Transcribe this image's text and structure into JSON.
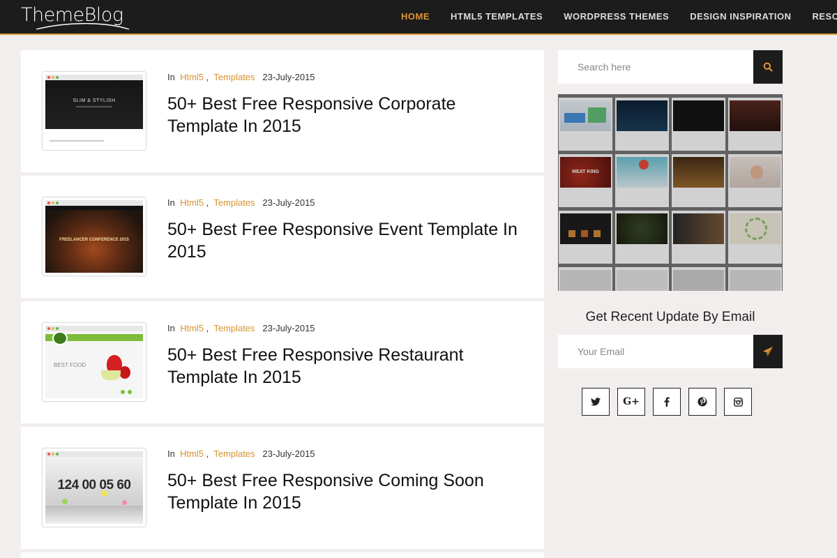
{
  "header": {
    "logo": "ThemeBlog",
    "nav": [
      {
        "label": "HOME",
        "active": true
      },
      {
        "label": "HTML5 TEMPLATES",
        "active": false
      },
      {
        "label": "WORDPRESS THEMES",
        "active": false
      },
      {
        "label": "DESIGN INSPIRATION",
        "active": false
      },
      {
        "label": "RESOURCE",
        "active": false
      }
    ]
  },
  "posts": [
    {
      "meta_prefix": "In",
      "cat1": "Html5",
      "sep": ",",
      "cat2": "Templates",
      "date": "23-July-2015",
      "title": "50+ Best Free Responsive Corporate Template In 2015",
      "thumb_text": "SLIM & STYLISH"
    },
    {
      "meta_prefix": "In",
      "cat1": "Html5",
      "sep": ",",
      "cat2": "Templates",
      "date": "23-July-2015",
      "title": "50+ Best Free Responsive Event Template In 2015",
      "thumb_text": "FREELANCER CONFERENCE 2015"
    },
    {
      "meta_prefix": "In",
      "cat1": "Html5",
      "sep": ",",
      "cat2": "Templates",
      "date": "23-July-2015",
      "title": "50+ Best Free Responsive Restaurant Template In 2015",
      "thumb_text": "BEST FOOD"
    },
    {
      "meta_prefix": "In",
      "cat1": "Html5",
      "sep": ",",
      "cat2": "Templates",
      "date": "23-July-2015",
      "title": "50+ Best Free Responsive Coming Soon Template In 2015",
      "thumb_text": "124 00 05 60"
    }
  ],
  "sidebar": {
    "search_placeholder": "Search here",
    "email_heading": "Get Recent Update By Email",
    "email_placeholder": "Your Email",
    "collage_text": "MEAT KING",
    "socials": [
      "twitter-icon",
      "google-plus-icon",
      "facebook-icon",
      "pinterest-icon",
      "instagram-icon"
    ]
  },
  "colors": {
    "accent": "#e29535",
    "header_bg": "#1c1c1c",
    "page_bg": "#f2eeee"
  }
}
